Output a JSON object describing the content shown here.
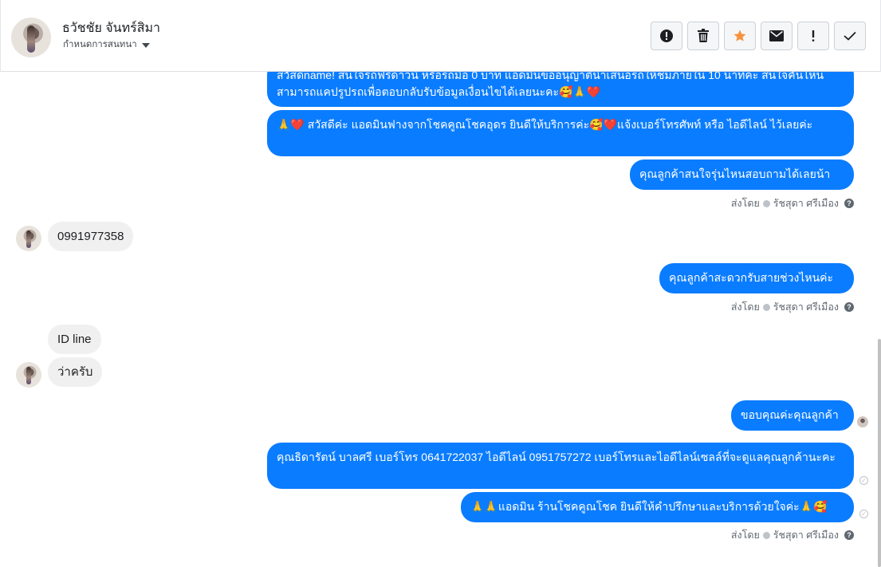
{
  "header": {
    "contact_name": "ธวัชชัย จันทร์สิมา",
    "assign_label": "กำหนดการสนทนา",
    "toolbar": [
      {
        "icon": "alert-circle-icon",
        "glyph": "!"
      },
      {
        "icon": "trash-icon",
        "glyph": "🗑"
      },
      {
        "icon": "star-icon",
        "glyph": "★"
      },
      {
        "icon": "envelope-icon",
        "glyph": "✉"
      },
      {
        "icon": "exclamation-icon",
        "glyph": "!"
      },
      {
        "icon": "check-icon",
        "glyph": "✓"
      }
    ],
    "colors": {
      "star": "#f7923b"
    }
  },
  "messages": {
    "m1": "สวัสดีname! สนใจรถฟรีดาวน์ หรือรถมือ 0 บาท แอดมินขออนุญาตินำเสนอรถให้ชมภายใน 10 นาทีค่ะ สนใจคันไหนสามารถแคปรูปรถเพื่อตอบกลับรับข้อมูลเงื่อนไขได้เลยนะคะ🥰🙏❤️",
    "m2": "🙏❤️ สวัสดีค่ะ แอดมินฟางจากโชคคูณโชคอุดร ยินดีให้บริการค่ะ🥰❤️แจ้งเบอร์โทรศัพท์ หรือ ไอดีไลน์  ไว้เลยค่ะ",
    "m3": "คุณลูกค้าสนใจรุ่นไหนสอบถามได้เลยน้า",
    "sent_by_1": "ส่งโดย",
    "agent_1": "รัชสุดา ศรีเมือง",
    "in1": "0991977358",
    "m4": "คุณลูกค้าสะดวกรับสายช่วงไหนค่ะ",
    "sent_by_2": "ส่งโดย",
    "agent_2": "รัชสุดา ศรีเมือง",
    "in2": "ID line",
    "in3": "ว่าครับ",
    "m5": "ขอบคุณค่ะคุณลูกค้า",
    "m6": "คุณธิดารัตน์ บาลศรี เบอร์โทร 0641722037  ไอดีไลน์ 0951757272   เบอร์โทรและไอดีไลน์เซลล์ที่จะดูแลคุณลูกค้านะคะ",
    "m7": "🙏🙏แอดมิน ร้านโชคคูณโชค ยินดีให้คำปรึกษาและบริการด้วยใจค่ะ🙏🥰",
    "sent_by_3": "ส่งโดย",
    "agent_3": "รัชสุดา ศรีเมือง"
  },
  "colors": {
    "outgoing_bubble": "#0a7cff",
    "incoming_bubble": "#f1f0f0"
  }
}
